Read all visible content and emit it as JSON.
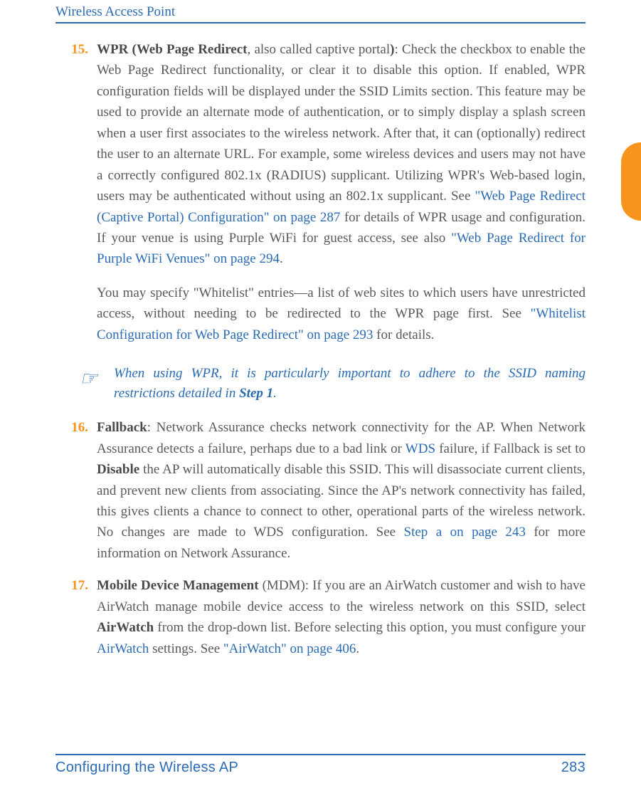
{
  "header": {
    "running_title": "Wireless Access Point"
  },
  "items": [
    {
      "num": "15.",
      "lead": "WPR (Web Page Redirect",
      "tail1": ", also called captive portal",
      "close_bold": ")",
      "tail2": ": Check the checkbox to enable the Web Page Redirect functionality, or clear it to disable this option. If enabled, WPR configuration fields will be displayed under the SSID Limits section. This feature may be used to provide an alternate mode of authentication, or to simply display a splash screen when a user first associates to the wireless network. After that, it can (optionally) redirect the user to an alternate URL. For example, some wireless devices and users may not have a correctly configured 802.1x (RADIUS) supplicant. Utilizing WPR's Web-based login, users may be authenticated without using an 802.1x supplicant. See ",
      "link1": "\"Web Page Redirect (Captive Portal) Configuration\" on page 287",
      "tail3": " for details of WPR usage and configuration. If your venue is using Purple WiFi for guest access, see also ",
      "link2": "\"Web Page Redirect for Purple WiFi Venues\" on page 294",
      "tail4": ".",
      "sub_pre": "You may specify \"Whitelist\" entries—a list of web sites to which users have unrestricted access, without needing to be redirected to the WPR page first. See ",
      "sub_link": "\"Whitelist Configuration for Web Page Redirect\" on page 293",
      "sub_post": " for details."
    },
    {
      "num": "16.",
      "lead": "Fallback",
      "tail2": ": Network Assurance checks network connectivity for the AP. When Network Assurance detects a failure, perhaps due to a bad link or ",
      "link0": "WDS",
      "tail2b": " failure, if Fallback is set to ",
      "bold_inline": "Disable",
      "tail2c": " the AP will automatically disable this SSID. This will disassociate current clients, and prevent new clients from associating. Since the AP's network connectivity has failed, this gives clients a chance to connect to other, operational parts of the wireless network. No changes are made to WDS configuration. See ",
      "link1": "Step a on page 243",
      "tail3": " for more information on Network Assurance."
    },
    {
      "num": "17.",
      "lead": "Mobile Device Management",
      "tail2": " (MDM): If you are an AirWatch customer and wish to have AirWatch manage mobile device access to the wireless network on this SSID, select ",
      "bold_inline": "AirWatch",
      "tail2c": " from the drop-down list. Before selecting this option, you must configure your ",
      "link0": "AirWatch",
      "tail2d": " settings. See ",
      "link1": "\"AirWatch\" on page 406",
      "tail3": "."
    }
  ],
  "note": {
    "text_pre": "When using WPR, it is particularly important to adhere to the SSID naming restrictions detailed in ",
    "bold": "Step 1",
    "text_post": "."
  },
  "footer": {
    "left": "Configuring the Wireless AP",
    "right": "283"
  }
}
